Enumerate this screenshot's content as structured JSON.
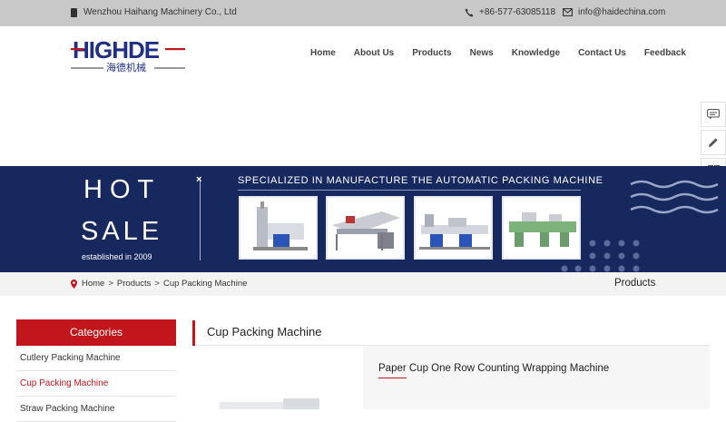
{
  "topbar": {
    "company": "Wenzhou Haihang Machinery Co., Ltd",
    "phone": "+86-577-63085118",
    "email": "info@haidechina.com"
  },
  "logo": {
    "text": "HIGHDE",
    "sub": "海德机械"
  },
  "nav": {
    "items": [
      "Home",
      "About Us",
      "Products",
      "News",
      "Knowledge",
      "Contact Us",
      "Feedback"
    ]
  },
  "sidetools": [
    "message-icon",
    "edit-icon",
    "qrcode-icon"
  ],
  "banner": {
    "hot": "HOT",
    "sale": "SALE",
    "established": "established in 2009",
    "tagline": "SPECIALIZED IN MANUFACTURE THE AUTOMATIC PACKING MACHINE",
    "close": "×"
  },
  "breadcrumb": {
    "home": "Home",
    "products": "Products",
    "current": "Cup Packing Machine",
    "sep": ">",
    "right_title": "Products"
  },
  "sidebar": {
    "heading": "Categories",
    "items": [
      "Cutlery Packing Machine",
      "Cup Packing Machine",
      "Straw Packing Machine"
    ],
    "active_index": 1
  },
  "main": {
    "title": "Cup Packing Machine",
    "products": [
      {
        "title": "Paper Cup One Row Counting Wrapping Machine"
      }
    ]
  },
  "colors": {
    "accent": "#c0161c",
    "banner_bg": "#16285d",
    "topbar_bg": "#c8c8c8",
    "logo_blue": "#1f2f86"
  }
}
